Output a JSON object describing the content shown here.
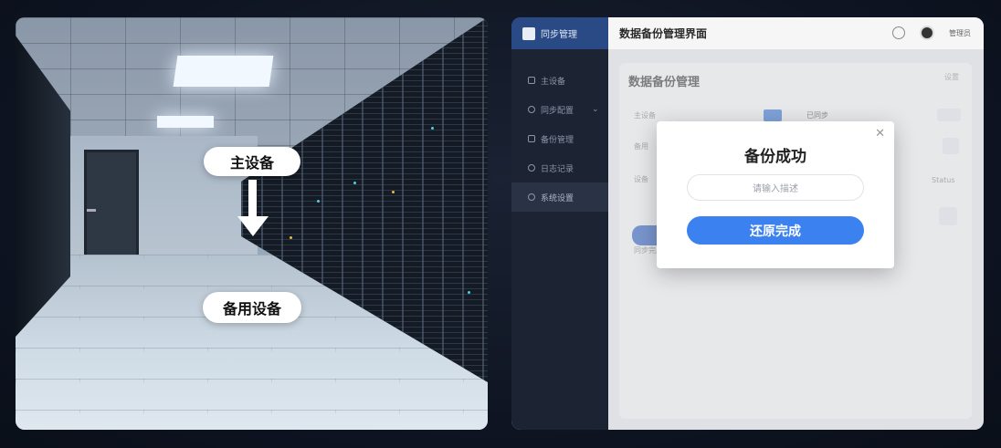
{
  "photo": {
    "label_primary": "主设备",
    "label_backup": "备用设备"
  },
  "app": {
    "brand": "同步管理",
    "title": "数据备份管理界面",
    "user_name": "管理员",
    "sidebar": {
      "items": [
        {
          "label": "主设备",
          "icon": "server-icon"
        },
        {
          "label": "同步配置",
          "icon": "sync-icon"
        },
        {
          "label": "备份管理",
          "icon": "backup-icon"
        },
        {
          "label": "日志记录",
          "icon": "log-icon"
        },
        {
          "label": "系统设置",
          "icon": "settings-icon"
        }
      ]
    },
    "card": {
      "title": "数据备份管理",
      "tag": "设置",
      "row1_label": "主设备",
      "row1_status": "已同步",
      "row2_label": "备用",
      "row3_label": "设备",
      "row3_value": "Status",
      "footer_label": "同步完成"
    },
    "modal": {
      "title": "备份成功",
      "input_placeholder": "请输入描述",
      "button_label": "还原完成",
      "close_icon": "close-icon"
    },
    "colors": {
      "sidebar_bg": "#1c2433",
      "brand_bg": "#2a4a86",
      "primary_button": "#3b82f0"
    }
  }
}
